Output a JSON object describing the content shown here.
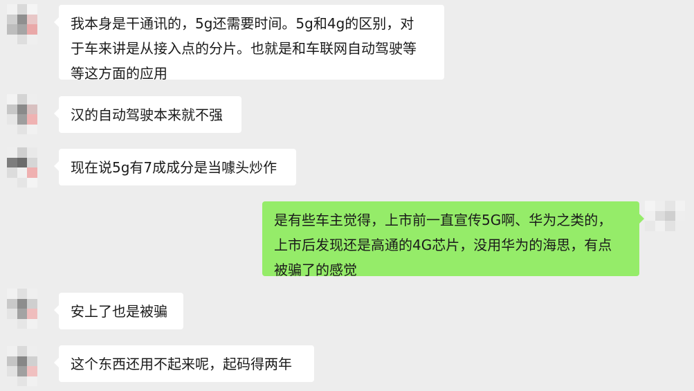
{
  "colors": {
    "background": "#ededed",
    "incoming_bubble": "#ffffff",
    "outgoing_bubble": "#95ec69",
    "text": "#1a1a1a"
  },
  "messages": [
    {
      "direction": "incoming",
      "avatar_icon": "pixelated-avatar-icon",
      "lines": [
        "我本身是干通讯的，5g还需要时间。5g和4g的区别，对",
        "于车来讲是从接入点的分片。也就是和车联网自动驾驶等",
        "等这方面的应用"
      ]
    },
    {
      "direction": "incoming",
      "avatar_icon": "pixelated-avatar-icon",
      "lines": [
        "汉的自动驾驶本来就不强"
      ]
    },
    {
      "direction": "incoming",
      "avatar_icon": "pixelated-avatar-icon",
      "lines": [
        "现在说5g有7成成分是当噱头炒作"
      ]
    },
    {
      "direction": "outgoing",
      "avatar_icon": "pixelated-avatar-icon",
      "lines": [
        "是有些车主觉得，上市前一直宣传5G啊、华为之类的，",
        "上市后发现还是高通的4G芯片，没用华为的海思，有点",
        "被骗了的感觉"
      ]
    },
    {
      "direction": "incoming",
      "avatar_icon": "pixelated-avatar-icon",
      "lines": [
        "安上了也是被骗"
      ]
    },
    {
      "direction": "incoming",
      "avatar_icon": "pixelated-avatar-icon",
      "lines": [
        "这个东西还用不起来呢，起码得两年"
      ]
    }
  ]
}
